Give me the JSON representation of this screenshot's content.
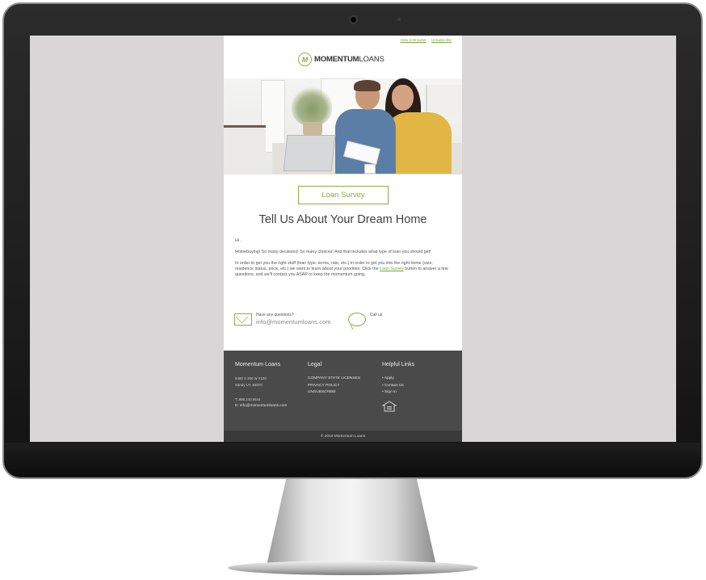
{
  "email": {
    "top_links": [
      "View in Browser",
      "Unsubscribe"
    ],
    "logo": {
      "mark": "M",
      "text_bold": "MOMENTUM",
      "text_light": "LOANS"
    },
    "hero_icon": "photo-couple-laptop",
    "cta_label": "Loan Survey",
    "headline": "Tell Us About Your Dream Home",
    "greeting": "Hi ,",
    "paragraph1": "Homebuying! So many decisions! So many choices! And that includes what type of loan you should get!",
    "paragraph2_before": "In order to get you the right stuff (loan type, terms, rate, etc.) in order to get you into the right home (size, residence status, price, etc.) we want to learn about your priorities. Click the",
    "paragraph2_link": "Loan Survey",
    "paragraph2_after": "button to answer a few questions, and we'll contact you ASAP to keep the momentum going.",
    "contact": {
      "questions_label": "Have any questions?",
      "email": "info@momentumloans.com",
      "call_label": "Call us",
      "mail_icon": "envelope-icon",
      "chat_icon": "speech-bubble-icon"
    }
  },
  "footer": {
    "col1": {
      "title": "Momentum Loans",
      "address1": "9490 S 300 W #100",
      "address2": "Sandy UT, 84070",
      "phone": "T: 888.240.6644",
      "email": "E: info@momentumloans.com"
    },
    "col2": {
      "title": "Legal",
      "items": [
        "COMPANY STATE LICENSES",
        "PRIVACY POLICY",
        "UNSUBSCRIBE"
      ]
    },
    "col3": {
      "title": "Helpful Links",
      "items": [
        "• Apply",
        "• Contact Us",
        "• Sign In"
      ],
      "badge_icon": "equal-housing-opportunity-icon"
    },
    "copyright": "© 2018 Momentum Loans"
  },
  "colors": {
    "accent": "#86b33e",
    "footer_bg": "#4a4a4a",
    "copyright_bg": "#3a3a3a",
    "screen_bg": "#d8d6d6"
  }
}
